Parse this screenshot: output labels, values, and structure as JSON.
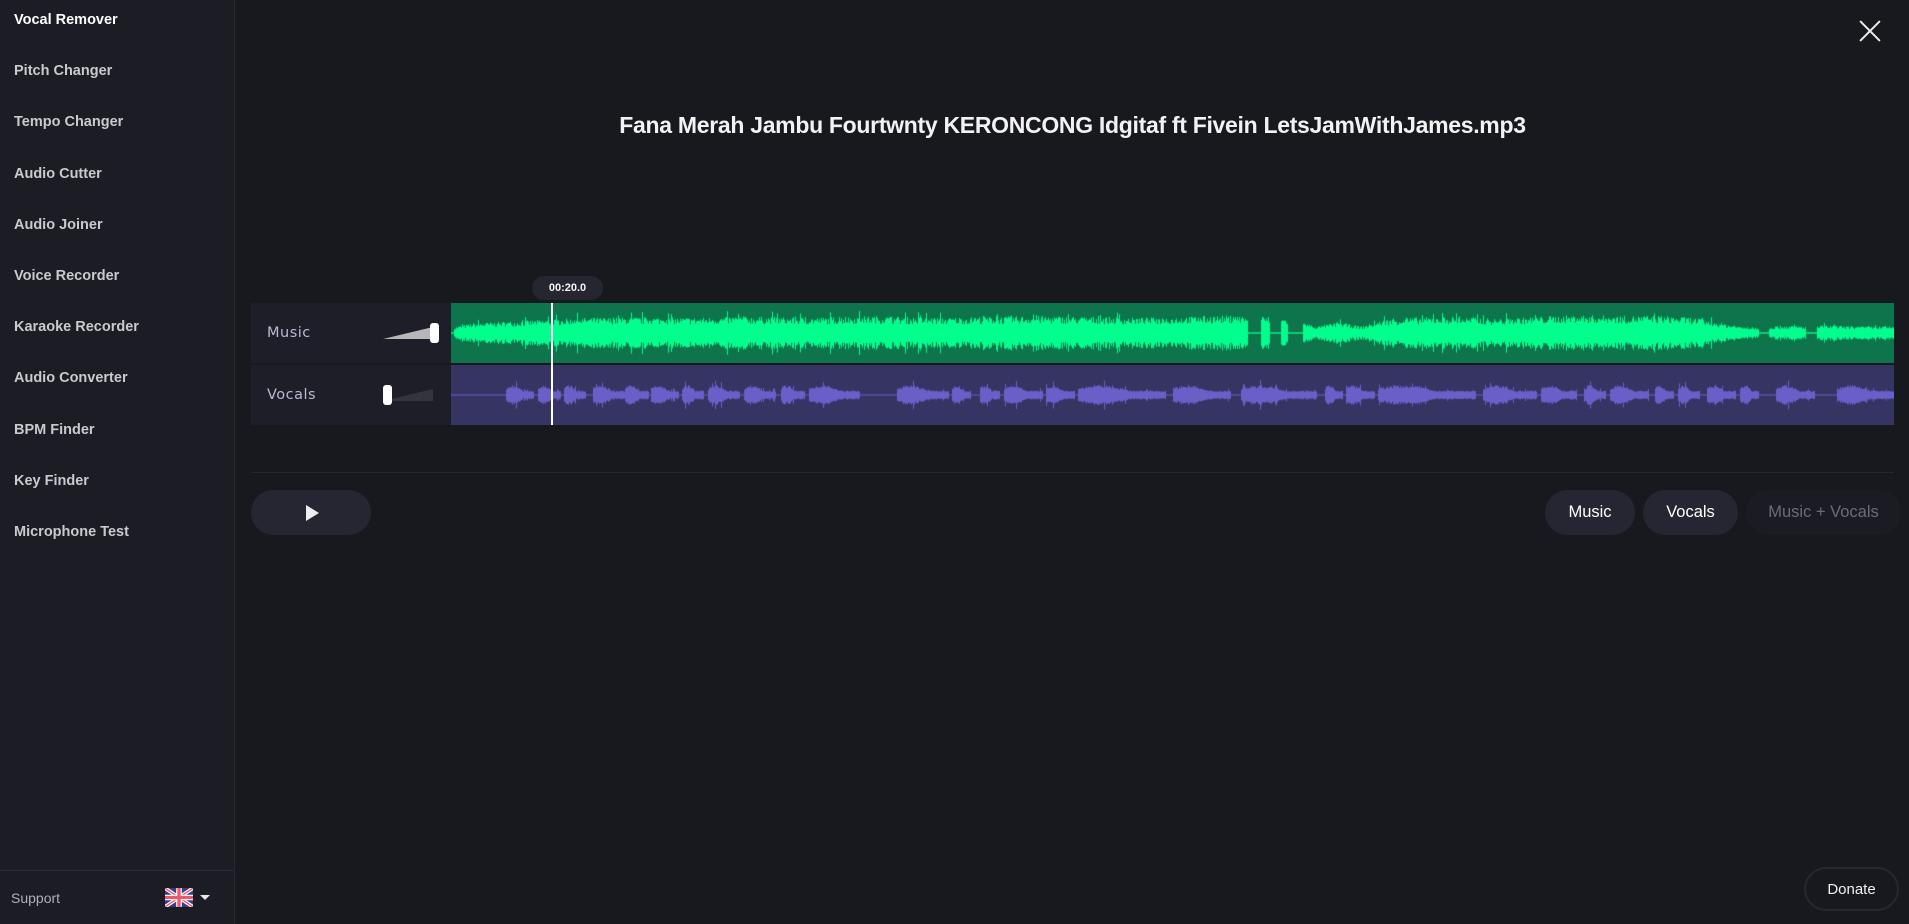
{
  "sidebar": {
    "items": [
      {
        "label": "Vocal Remover",
        "active": true
      },
      {
        "label": "Pitch Changer",
        "active": false
      },
      {
        "label": "Tempo Changer",
        "active": false
      },
      {
        "label": "Audio Cutter",
        "active": false
      },
      {
        "label": "Audio Joiner",
        "active": false
      },
      {
        "label": "Voice Recorder",
        "active": false
      },
      {
        "label": "Karaoke Recorder",
        "active": false
      },
      {
        "label": "Audio Converter",
        "active": false
      },
      {
        "label": "BPM Finder",
        "active": false
      },
      {
        "label": "Key Finder",
        "active": false
      },
      {
        "label": "Microphone Test",
        "active": false
      }
    ],
    "footer": {
      "support_label": "Support",
      "language_icon": "uk-flag-icon"
    }
  },
  "header": {
    "close_icon": "close-icon",
    "file_title": "Fana Merah Jambu Fourtwnty KERONCONG Idgitaf ft Fivein LetsJamWithJames.mp3"
  },
  "editor": {
    "current_time": "00:20.0",
    "playhead_fraction": 0.069,
    "tracks": [
      {
        "name": "Music",
        "volume": 1.0,
        "colors": {
          "background": "#0e744c",
          "wave": "#00ff8c"
        },
        "silent_ranges": [
          [
            0.0,
            0.002
          ],
          [
            0.552,
            0.561
          ],
          [
            0.567,
            0.575
          ],
          [
            0.58,
            0.59
          ],
          [
            0.906,
            0.913
          ],
          [
            0.939,
            0.946
          ]
        ],
        "envelope": [
          0.25,
          0.45,
          0.5,
          0.55,
          0.6,
          0.65,
          0.7,
          0.7,
          0.72,
          0.72,
          0.7,
          0.7,
          0.72,
          0.75,
          0.75,
          0.72,
          0.7,
          0.72,
          0.75,
          0.78,
          0.75,
          0.72,
          0.7,
          0.72,
          0.75,
          0.75,
          0.78,
          0.78,
          0.75,
          0.75,
          0.72,
          0.7,
          0.72,
          0.75,
          0.78,
          0.8,
          0.78,
          0.75,
          0.6,
          0.3,
          0.5,
          0.3,
          0.6,
          0.7,
          0.72,
          0.75,
          0.7,
          0.65,
          0.7,
          0.75,
          0.8,
          0.82,
          0.8,
          0.78,
          0.8,
          0.78,
          0.7,
          0.5,
          0.3,
          0.25,
          0.35,
          0.3,
          0.35,
          0.3,
          0.3,
          0.3
        ]
      },
      {
        "name": "Vocals",
        "volume": 0.0,
        "colors": {
          "background": "#363462",
          "wave": "#6a5fc8"
        },
        "active_ranges": [
          [
            0.038,
            0.057
          ],
          [
            0.06,
            0.076
          ],
          [
            0.078,
            0.093
          ],
          [
            0.098,
            0.12
          ],
          [
            0.12,
            0.137
          ],
          [
            0.138,
            0.158
          ],
          [
            0.16,
            0.175
          ],
          [
            0.178,
            0.2
          ],
          [
            0.203,
            0.225
          ],
          [
            0.228,
            0.245
          ],
          [
            0.248,
            0.283
          ],
          [
            0.309,
            0.345
          ],
          [
            0.347,
            0.36
          ],
          [
            0.366,
            0.38
          ],
          [
            0.383,
            0.41
          ],
          [
            0.412,
            0.432
          ],
          [
            0.434,
            0.495
          ],
          [
            0.5,
            0.54
          ],
          [
            0.547,
            0.6
          ],
          [
            0.605,
            0.618
          ],
          [
            0.62,
            0.64
          ],
          [
            0.642,
            0.71
          ],
          [
            0.715,
            0.752
          ],
          [
            0.755,
            0.78
          ],
          [
            0.785,
            0.8
          ],
          [
            0.803,
            0.83
          ],
          [
            0.834,
            0.847
          ],
          [
            0.85,
            0.865
          ],
          [
            0.87,
            0.89
          ],
          [
            0.893,
            0.906
          ],
          [
            0.918,
            0.945
          ],
          [
            0.96,
            1.0
          ]
        ]
      }
    ]
  },
  "controls": {
    "play_icon": "play-icon",
    "modes": [
      {
        "label": "Music",
        "selected": false
      },
      {
        "label": "Vocals",
        "selected": false
      },
      {
        "label": "Music + Vocals",
        "selected": true
      }
    ]
  },
  "footer": {
    "donate_label": "Donate"
  }
}
